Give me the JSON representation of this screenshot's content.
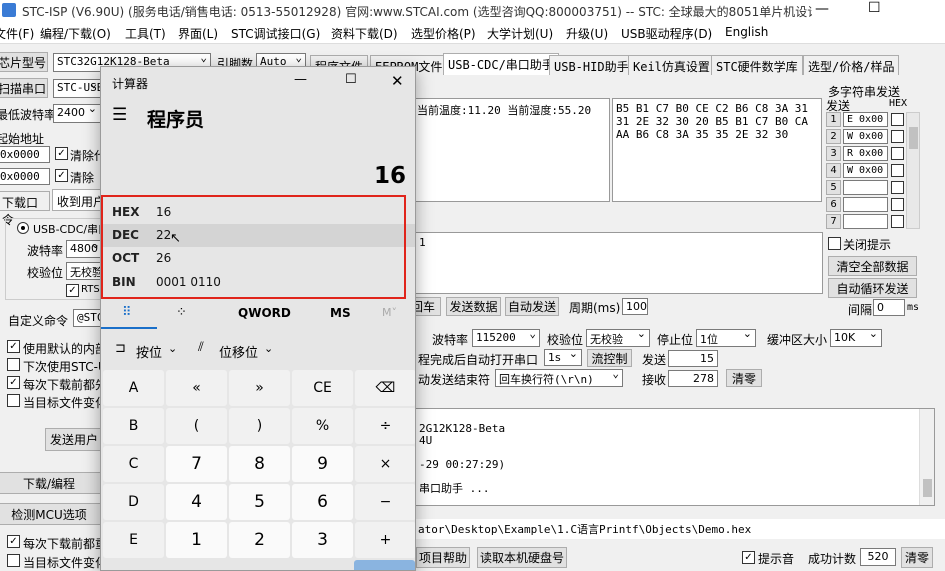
{
  "window": {
    "title": "STC-ISP (V6.90U) (服务电话/销售电话: 0513-55012928) 官网:www.STCAI.com (选型咨询QQ:800003751) -- STC: 全球最大的8051单片机设计..."
  },
  "menu": [
    "文件(F)",
    "编程/下载(O)",
    "工具(T)",
    "界面(L)",
    "STC调试接口(G)",
    "资料下载(D)",
    "选型价格(P)",
    "大学计划(U)",
    "升级(U)",
    "USB驱动程序(D)",
    "English"
  ],
  "left": {
    "chip_label": "芯片型号",
    "chip_value": "STC32G12K128-Beta",
    "pins_label": "引脚数",
    "pins_value": "Auto",
    "scan_button": "扫描串口",
    "port_value": "STC-USB",
    "min_baud_label": "最低波特率",
    "min_baud_value": "2400",
    "start_addr_label": "起始地址",
    "addr1": "0x0000",
    "addr2": "0x0000",
    "clear1": "清除代",
    "clear2": "清除",
    "download_tab": "下载口令",
    "recv_tab": "收到用户",
    "usbcdc_radio": "USB-CDC/串口",
    "baud_label": "波特率",
    "baud_value": "4800",
    "parity_label": "校验位",
    "parity_value": "无校验",
    "rts_label": "RTS",
    "custom_cmd_label": "自定义命令",
    "custom_cmd_value": "@STC",
    "opt1": "使用默认的内部",
    "opt2": "下次使用STC-U",
    "opt3": "每次下载前都先",
    "opt4": "当目标文件变化",
    "send_user_btn": "发送用户",
    "download_btn": "下载/编程",
    "detect_btn": "检测MCU选项",
    "bottom_opt1": "每次下载前都重新",
    "bottom_opt2": "当目标文件变化时"
  },
  "tabs": [
    "程序文件",
    "EEPROM文件",
    "USB-CDC/串口助手",
    "USB-HID助手",
    "Keil仿真设置",
    "STC硬件数学库",
    "选型/价格/样品"
  ],
  "serial": {
    "recv_text": "当前温度:11.20 当前湿度:55.20",
    "hex_text": "B5 B1 C7 B0 CE C2 B6 C8 3A 31 31 2E 32 30 20 B5 B1 C7 B0 CA AA B6 C8 3A 35 35 2E 32 30",
    "send_text": "1",
    "crlf_btn": "回车",
    "send_data_btn": "发送数据",
    "auto_send_btn": "自动发送",
    "period_label": "周期(ms)",
    "period_value": "100",
    "baud_label": "波特率",
    "baud_value": "115200",
    "parity_label": "校验位",
    "parity_value": "无校验",
    "stop_label": "停止位",
    "stop_value": "1位",
    "buffer_label": "缓冲区大小",
    "buffer_value": "10K",
    "auto_open_label": "程完成后自动打开串口",
    "auto_open_value": "1s",
    "flow_btn": "流控制",
    "send_count_label": "发送",
    "send_count": "15",
    "end_label": "动发送结束符",
    "end_value": "回车换行符(\\r\\n)",
    "recv_count_label": "接收",
    "recv_count": "278",
    "clear_btn": "清零"
  },
  "multi": {
    "title": "多字符串发送",
    "send_col": "发送",
    "hex_col": "HEX",
    "rows": [
      {
        "num": "1",
        "text": "E 0x00"
      },
      {
        "num": "2",
        "text": "W 0x00"
      },
      {
        "num": "3",
        "text": "R 0x00"
      },
      {
        "num": "4",
        "text": "W 0x00"
      },
      {
        "num": "5",
        "text": ""
      },
      {
        "num": "6",
        "text": ""
      },
      {
        "num": "7",
        "text": ""
      }
    ],
    "close_hint": "关闭提示",
    "clear_all": "清空全部数据",
    "auto_loop": "自动循环发送",
    "interval_label": "间隔",
    "interval_value": "0",
    "interval_unit": "ms"
  },
  "log": {
    "line1": "2G12K128-Beta",
    "line2": "4U",
    "line3": "-29 00:27:29)",
    "line4": "串口助手 ..."
  },
  "status": {
    "path": "ator\\Desktop\\Example\\1.C语言Printf\\Objects\\Demo.hex",
    "help_btn": "项目帮助",
    "read_disk_btn": "读取本机硬盘号",
    "beep_label": "提示音",
    "success_label": "成功计数",
    "success_value": "520",
    "clear_btn": "清零"
  },
  "calculator": {
    "title": "计算器",
    "mode": "程序员",
    "display": "16",
    "radix": [
      {
        "key": "HEX",
        "value": "16"
      },
      {
        "key": "DEC",
        "value": "22"
      },
      {
        "key": "OCT",
        "value": "26"
      },
      {
        "key": "BIN",
        "value": "0001 0110"
      }
    ],
    "word_size": "QWORD",
    "ms": "MS",
    "mplus": "M˅",
    "bitwise": "按位",
    "bitshift": "位移位",
    "keys": [
      [
        "A",
        "«",
        "»",
        "CE",
        "⌫"
      ],
      [
        "B",
        "(",
        ")",
        "%",
        "÷"
      ],
      [
        "C",
        "7",
        "8",
        "9",
        "×"
      ],
      [
        "D",
        "4",
        "5",
        "6",
        "−"
      ],
      [
        "E",
        "1",
        "2",
        "3",
        "+"
      ]
    ],
    "highlight_color": "#e0241b"
  }
}
